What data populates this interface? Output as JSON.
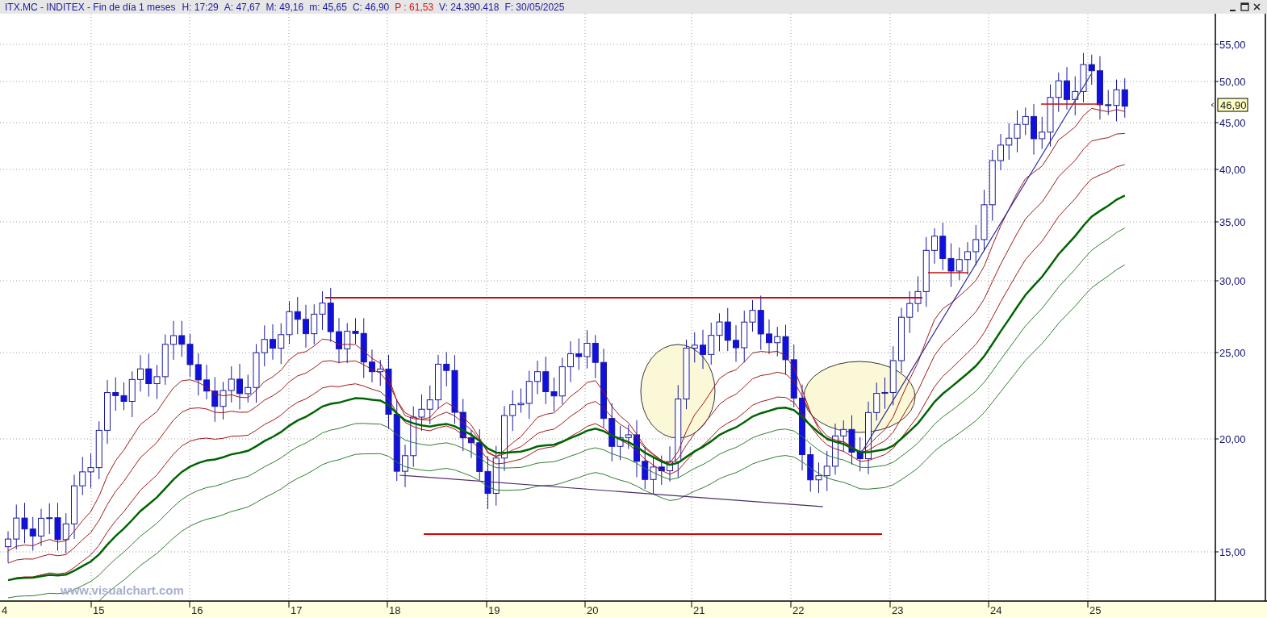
{
  "window": {
    "title": "ITX.MC - INDITEX - Fin de día 1 meses"
  },
  "quote": [
    {
      "text": "H: 17:29",
      "color": "#1a1aa0"
    },
    {
      "text": "A: 47,67",
      "color": "#1a1aa0"
    },
    {
      "text": "M: 49,16",
      "color": "#1a1aa0"
    },
    {
      "text": "m: 45,65",
      "color": "#1a1aa0"
    },
    {
      "text": "C: 46,90",
      "color": "#1a1aa0"
    },
    {
      "text": "P : 61,53",
      "color": "#e01010"
    },
    {
      "text": "V: 24.390.418",
      "color": "#1a1aa0"
    },
    {
      "text": "F: 30/05/2025",
      "color": "#1a1aa0"
    }
  ],
  "price_axis": {
    "labels": [
      "55,00",
      "50,00",
      "45,00",
      "40,00",
      "35,00",
      "30,00",
      "25,00",
      "20,00",
      "15,00"
    ],
    "current_price": "46,90"
  },
  "time_axis": {
    "labels": [
      "4",
      "15",
      "16",
      "17",
      "18",
      "19",
      "20",
      "21",
      "22",
      "23",
      "24",
      "25"
    ]
  },
  "watermark": "www.visualchart.com"
}
